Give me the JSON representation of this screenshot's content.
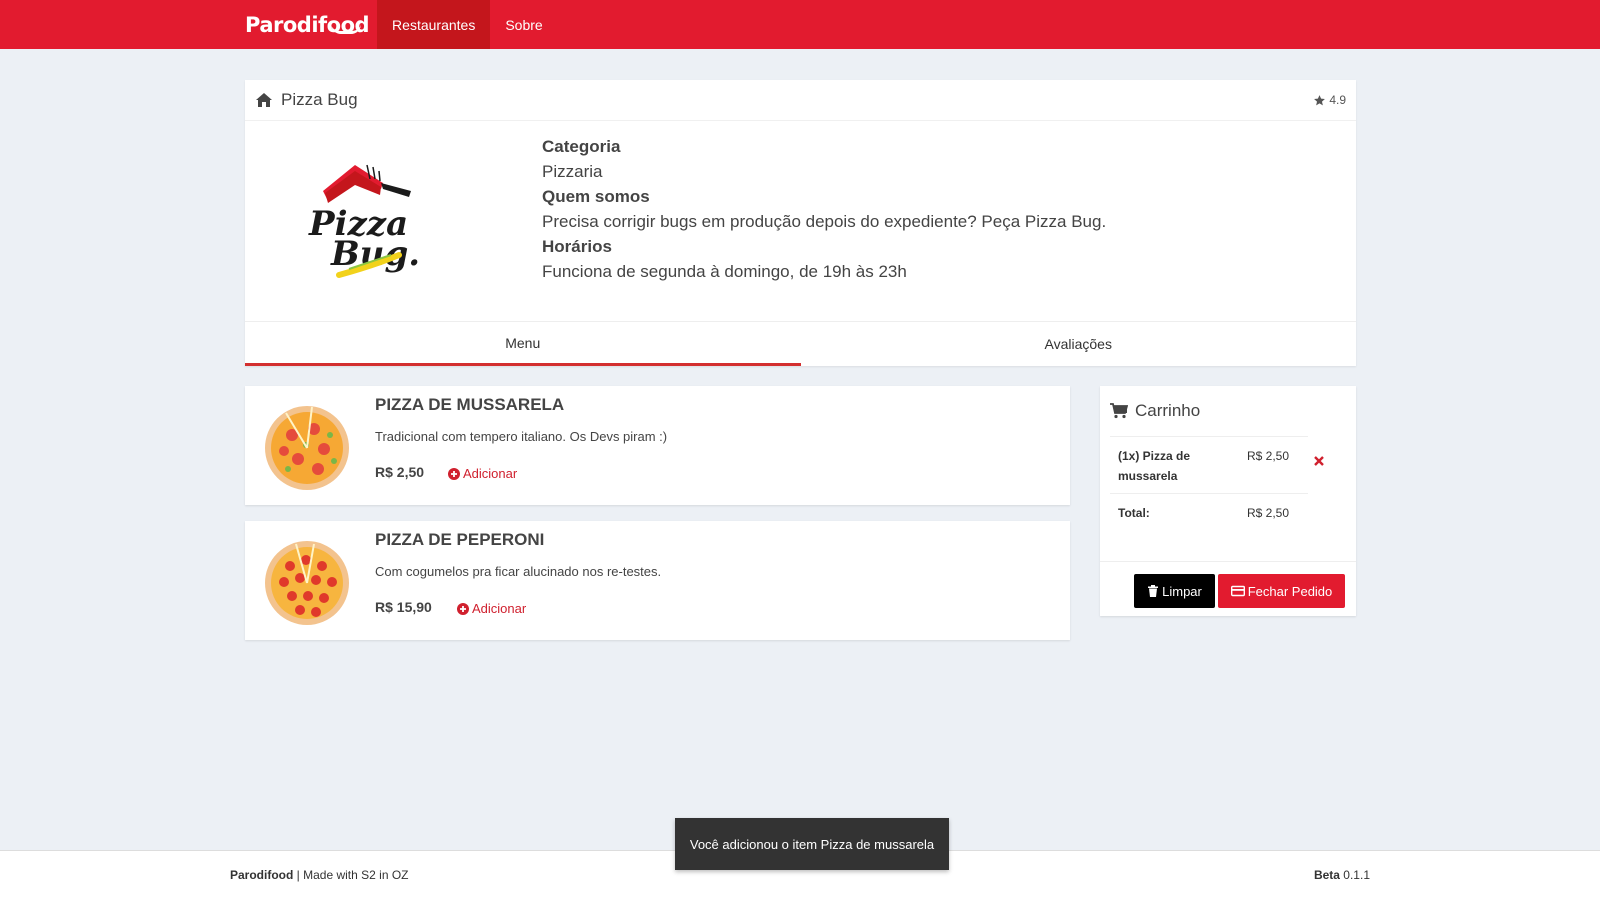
{
  "nav": {
    "brand": "Parodifood",
    "links": [
      {
        "label": "Restaurantes"
      },
      {
        "label": "Sobre"
      }
    ]
  },
  "restaurant": {
    "name": "Pizza Bug",
    "rating": "4.9",
    "category_label": "Categoria",
    "category": "Pizzaria",
    "about_label": "Quem somos",
    "about": "Precisa corrigir bugs em produção depois do expediente? Peça Pizza Bug.",
    "hours_label": "Horários",
    "hours": "Funciona de segunda à domingo, de 19h às 23h",
    "logo_text_1": "Pizza",
    "logo_text_2": "Bug."
  },
  "tabs": [
    {
      "label": "Menu",
      "active": true
    },
    {
      "label": "Avaliações",
      "active": false
    }
  ],
  "menu": [
    {
      "name": "PIZZA DE MUSSARELA",
      "description": "Tradicional com tempero italiano. Os Devs piram :)",
      "price": "R$ 2,50",
      "add_label": "Adicionar"
    },
    {
      "name": "PIZZA DE PEPERONI",
      "description": "Com cogumelos pra ficar alucinado nos re-testes.",
      "price": "R$ 15,90",
      "add_label": "Adicionar"
    }
  ],
  "cart": {
    "title": "Carrinho",
    "items": [
      {
        "label": "(1x) Pizza de mussarela",
        "price": "R$ 2,50"
      }
    ],
    "total_label": "Total:",
    "total_value": "R$ 2,50",
    "clear_label": "Limpar",
    "checkout_label": "Fechar Pedido"
  },
  "toast": {
    "message": "Você adicionou o item Pizza de mussarela"
  },
  "footer": {
    "brand": "Parodifood",
    "made_with": "| Made with S2 in OZ",
    "beta_label": "Beta",
    "version": "0.1.1"
  },
  "colors": {
    "brand_red": "#e21b2f",
    "nav_active": "#c4161c",
    "background": "#ecf0f5"
  }
}
